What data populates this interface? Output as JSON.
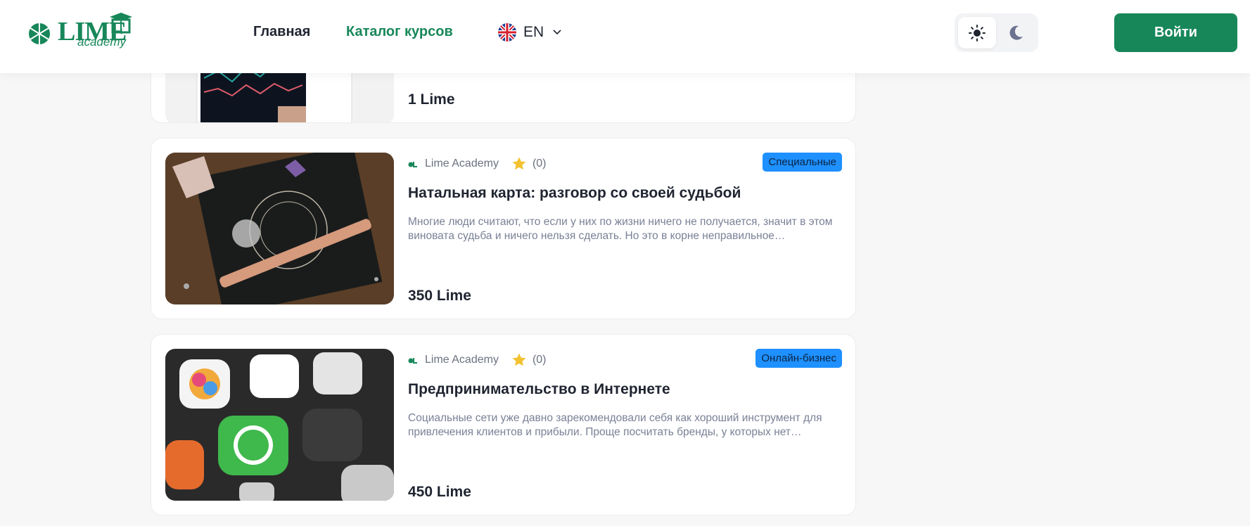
{
  "header": {
    "logo_main": "LIME",
    "logo_sub": "academy",
    "nav": {
      "home": "Главная",
      "catalog": "Каталог курсов"
    },
    "language": {
      "code": "EN",
      "flag_icon": "uk-flag-icon"
    },
    "theme": {
      "light_icon": "sun-icon",
      "dark_icon": "moon-icon",
      "active": "light"
    },
    "login_label": "Войти"
  },
  "colors": {
    "brand_green": "#17875a",
    "badge_blue": "#1e90ff",
    "text_dark": "#1f2430",
    "text_muted": "#7a8196"
  },
  "courses": [
    {
      "price": "1 Lime"
    },
    {
      "author": "Lime Academy",
      "rating": "(0)",
      "badge": "Специальные",
      "title": "Натальная карта: разговор со своей судьбой",
      "description": "Многие люди считают, что если у них по жизни ничего не получается, значит в этом виновата судьба и ничего нельзя сделать. Но это в корне неправильное…",
      "price": "350 Lime"
    },
    {
      "author": "Lime Academy",
      "rating": "(0)",
      "badge": "Онлайн-бизнес",
      "title": "Предпринимательство в Интернете",
      "description": "Социальные сети уже давно зарекомендовали себя как хороший инструмент для привлечения клиентов и прибыли. Проще посчитать бренды, у которых нет…",
      "price": "450 Lime"
    }
  ]
}
